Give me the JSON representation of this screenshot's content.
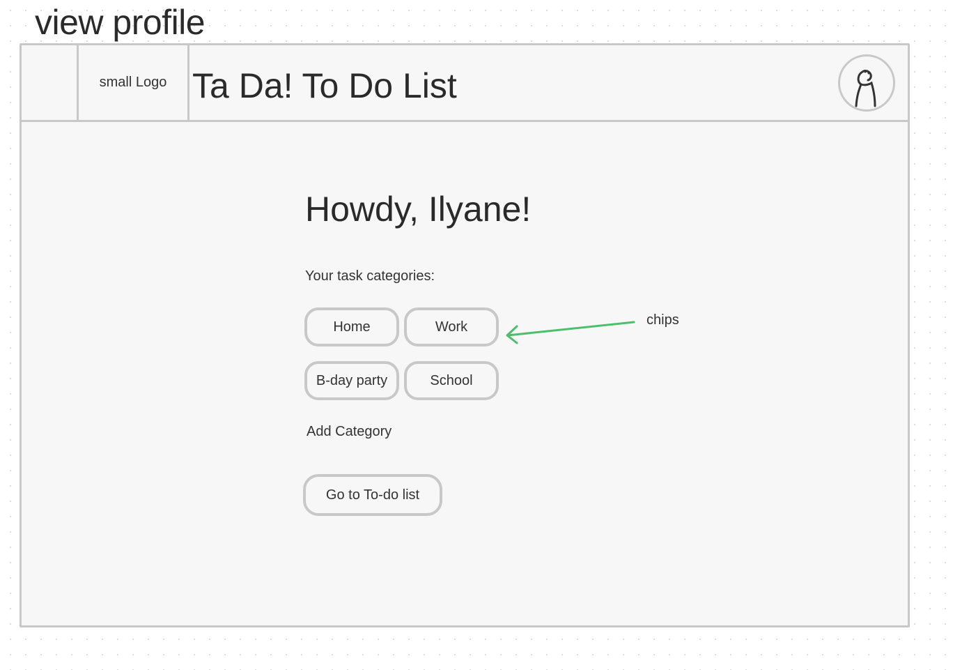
{
  "frame": {
    "title": "view profile"
  },
  "header": {
    "logo_label": "small Logo",
    "app_title": "Ta Da! To Do List",
    "avatar_icon": "user-avatar-icon"
  },
  "main": {
    "greeting": "Howdy, Ilyane!",
    "categories_label": "Your task categories:",
    "chips": [
      "Home",
      "Work",
      "B-day party",
      "School"
    ],
    "add_category_label": "Add Category",
    "goto_button_label": "Go to To-do list"
  },
  "annotation": {
    "label": "chips",
    "arrow_color": "#4cbf6b"
  },
  "colors": {
    "border": "#c8c8c8",
    "frame_background": "#f7f7f7",
    "text": "#2f2f2f"
  }
}
